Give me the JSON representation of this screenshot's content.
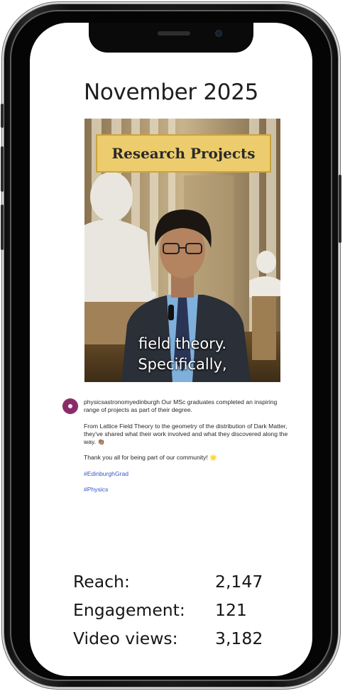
{
  "month_title": "November 2025",
  "video": {
    "banner_text": "Research Projects",
    "caption_line1": "field theory.",
    "caption_line2": "Specifically,"
  },
  "post": {
    "username": "physicsastronomyedinburgh",
    "intro_text": "Our MSc graduates completed an inspiring range of projects as part of their degree.",
    "paragraph2": "From Lattice Field Theory to the geometry of the distribution of Dark Matter, they've shared what their work involved and what they discovered along the way. 👏🏽",
    "paragraph3": "Thank you all for being part of our community! 🌟",
    "hashtags": [
      "#EdinburghGrad",
      "#Physics"
    ]
  },
  "stats": [
    {
      "label": "Reach:",
      "value": "2,147"
    },
    {
      "label": "Engagement:",
      "value": "121"
    },
    {
      "label": "Video views:",
      "value": "3,182"
    }
  ],
  "colors": {
    "banner_bg": "#eccc6c",
    "hashtag": "#3b55c4",
    "avatar": "#8a2a6a"
  }
}
